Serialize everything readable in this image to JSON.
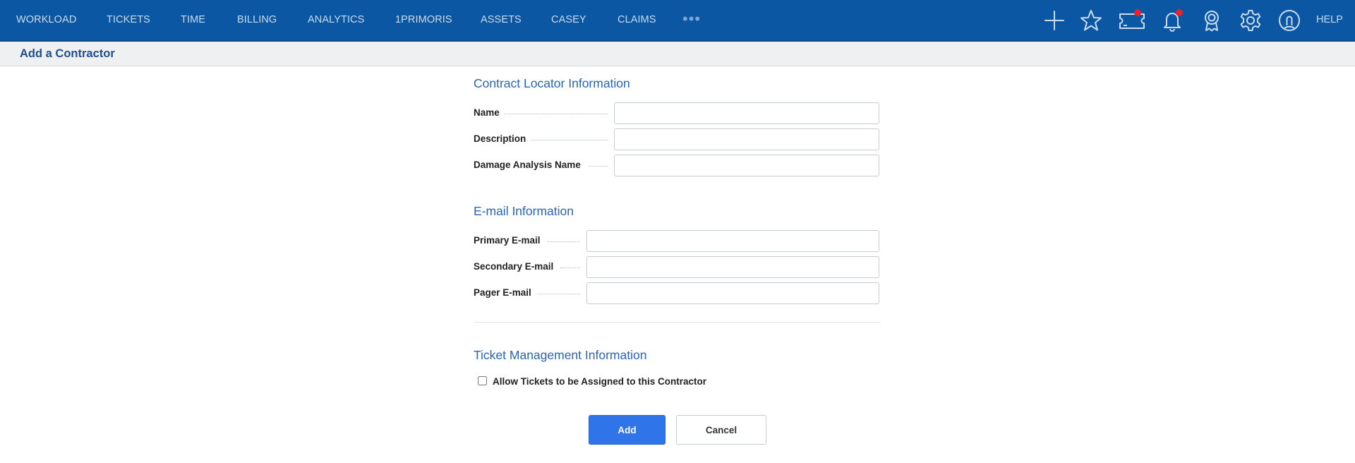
{
  "nav": {
    "items": [
      "WORKLOAD",
      "TICKETS",
      "TIME",
      "BILLING",
      "ANALYTICS",
      "1PRIMORIS",
      "ASSETS",
      "CASEY",
      "CLAIMS"
    ],
    "more": "•••",
    "icons": [
      "plus-icon",
      "star-icon",
      "ticket-icon",
      "bell-icon",
      "award-icon",
      "gear-icon",
      "user-icon"
    ],
    "help": "HELP",
    "background_color": "#0b57a4",
    "notification_color": "#e8212d"
  },
  "page": {
    "title": "Add a Contractor"
  },
  "sections": {
    "contract_locator": {
      "title": "Contract Locator Information",
      "fields": [
        {
          "label": "Name",
          "value": ""
        },
        {
          "label": "Description",
          "value": ""
        },
        {
          "label": "Damage Analysis Name",
          "value": ""
        }
      ]
    },
    "email": {
      "title": "E-mail Information",
      "fields": [
        {
          "label": "Primary E-mail",
          "value": ""
        },
        {
          "label": "Secondary E-mail",
          "value": ""
        },
        {
          "label": "Pager E-mail",
          "value": ""
        }
      ]
    },
    "ticket_management": {
      "title": "Ticket Management Information",
      "checkbox_label": "Allow Tickets to be Assigned to this Contractor",
      "checked": false
    }
  },
  "actions": {
    "add_label": "Add",
    "cancel_label": "Cancel",
    "accent_color": "#2f74e8"
  }
}
